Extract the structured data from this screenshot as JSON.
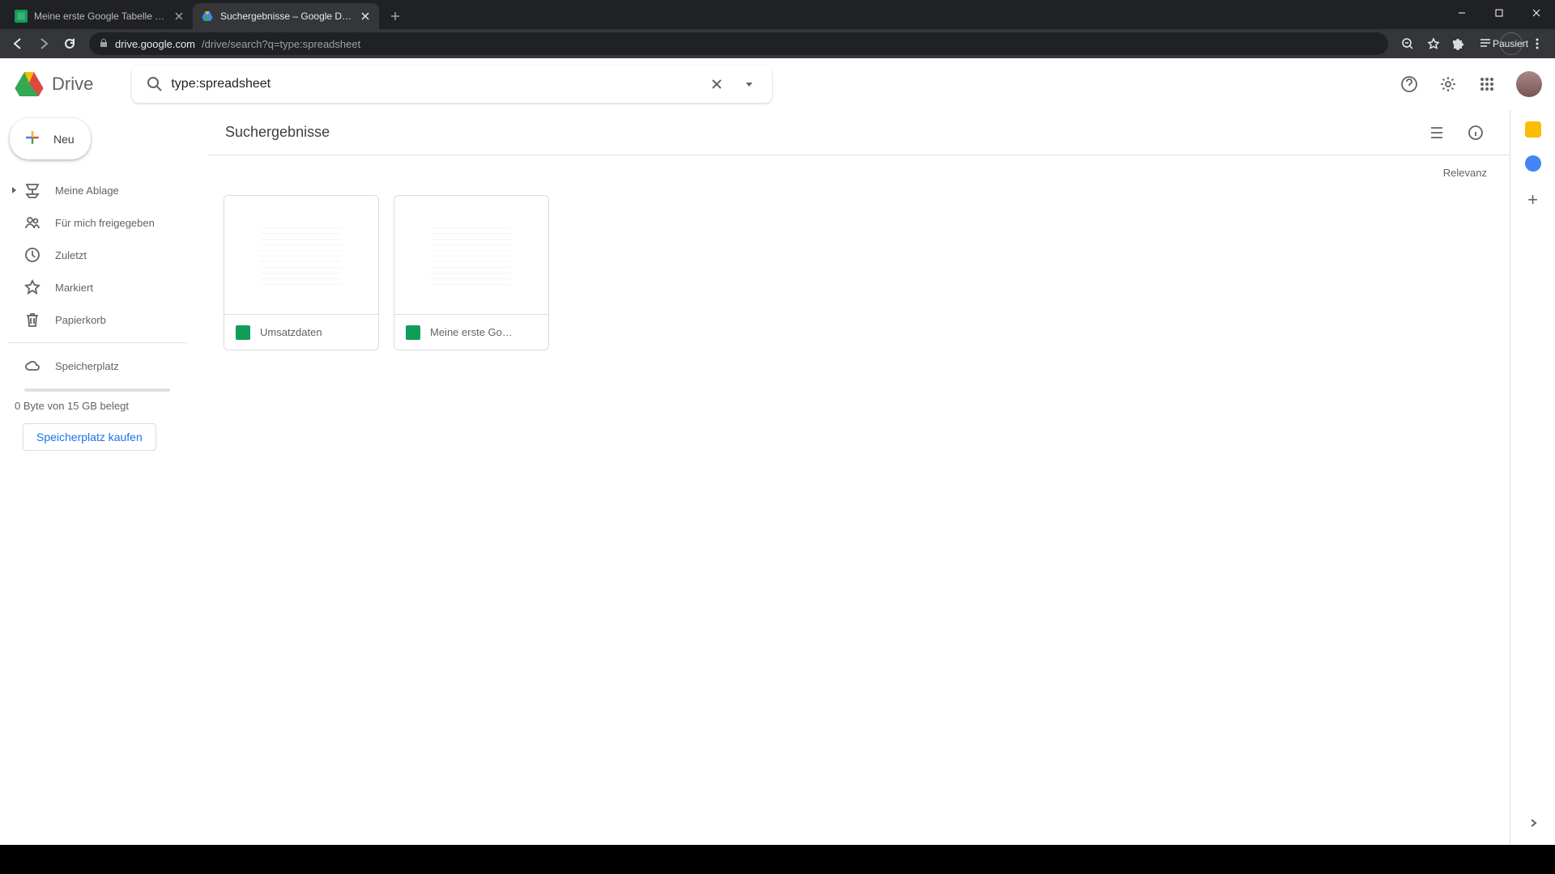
{
  "browser": {
    "tabs": [
      {
        "title": "Meine erste Google Tabelle - Go",
        "active": false
      },
      {
        "title": "Suchergebnisse – Google Drive",
        "active": true
      }
    ],
    "url_host": "drive.google.com",
    "url_path": "/drive/search?q=type:spreadsheet",
    "account_status": "Pausiert"
  },
  "header": {
    "app_name": "Drive",
    "search_value": "type:spreadsheet"
  },
  "sidebar": {
    "new_label": "Neu",
    "items": [
      {
        "label": "Meine Ablage",
        "icon": "my-drive",
        "expandable": true
      },
      {
        "label": "Für mich freigegeben",
        "icon": "shared"
      },
      {
        "label": "Zuletzt",
        "icon": "recent"
      },
      {
        "label": "Markiert",
        "icon": "starred"
      },
      {
        "label": "Papierkorb",
        "icon": "trash"
      }
    ],
    "storage_label": "Speicherplatz",
    "storage_usage": "0 Byte von 15 GB belegt",
    "buy_label": "Speicherplatz kaufen"
  },
  "main": {
    "title": "Suchergebnisse",
    "sort_label": "Relevanz",
    "files": [
      {
        "name": "Umsatzdaten"
      },
      {
        "name": "Meine erste Go…"
      }
    ]
  }
}
